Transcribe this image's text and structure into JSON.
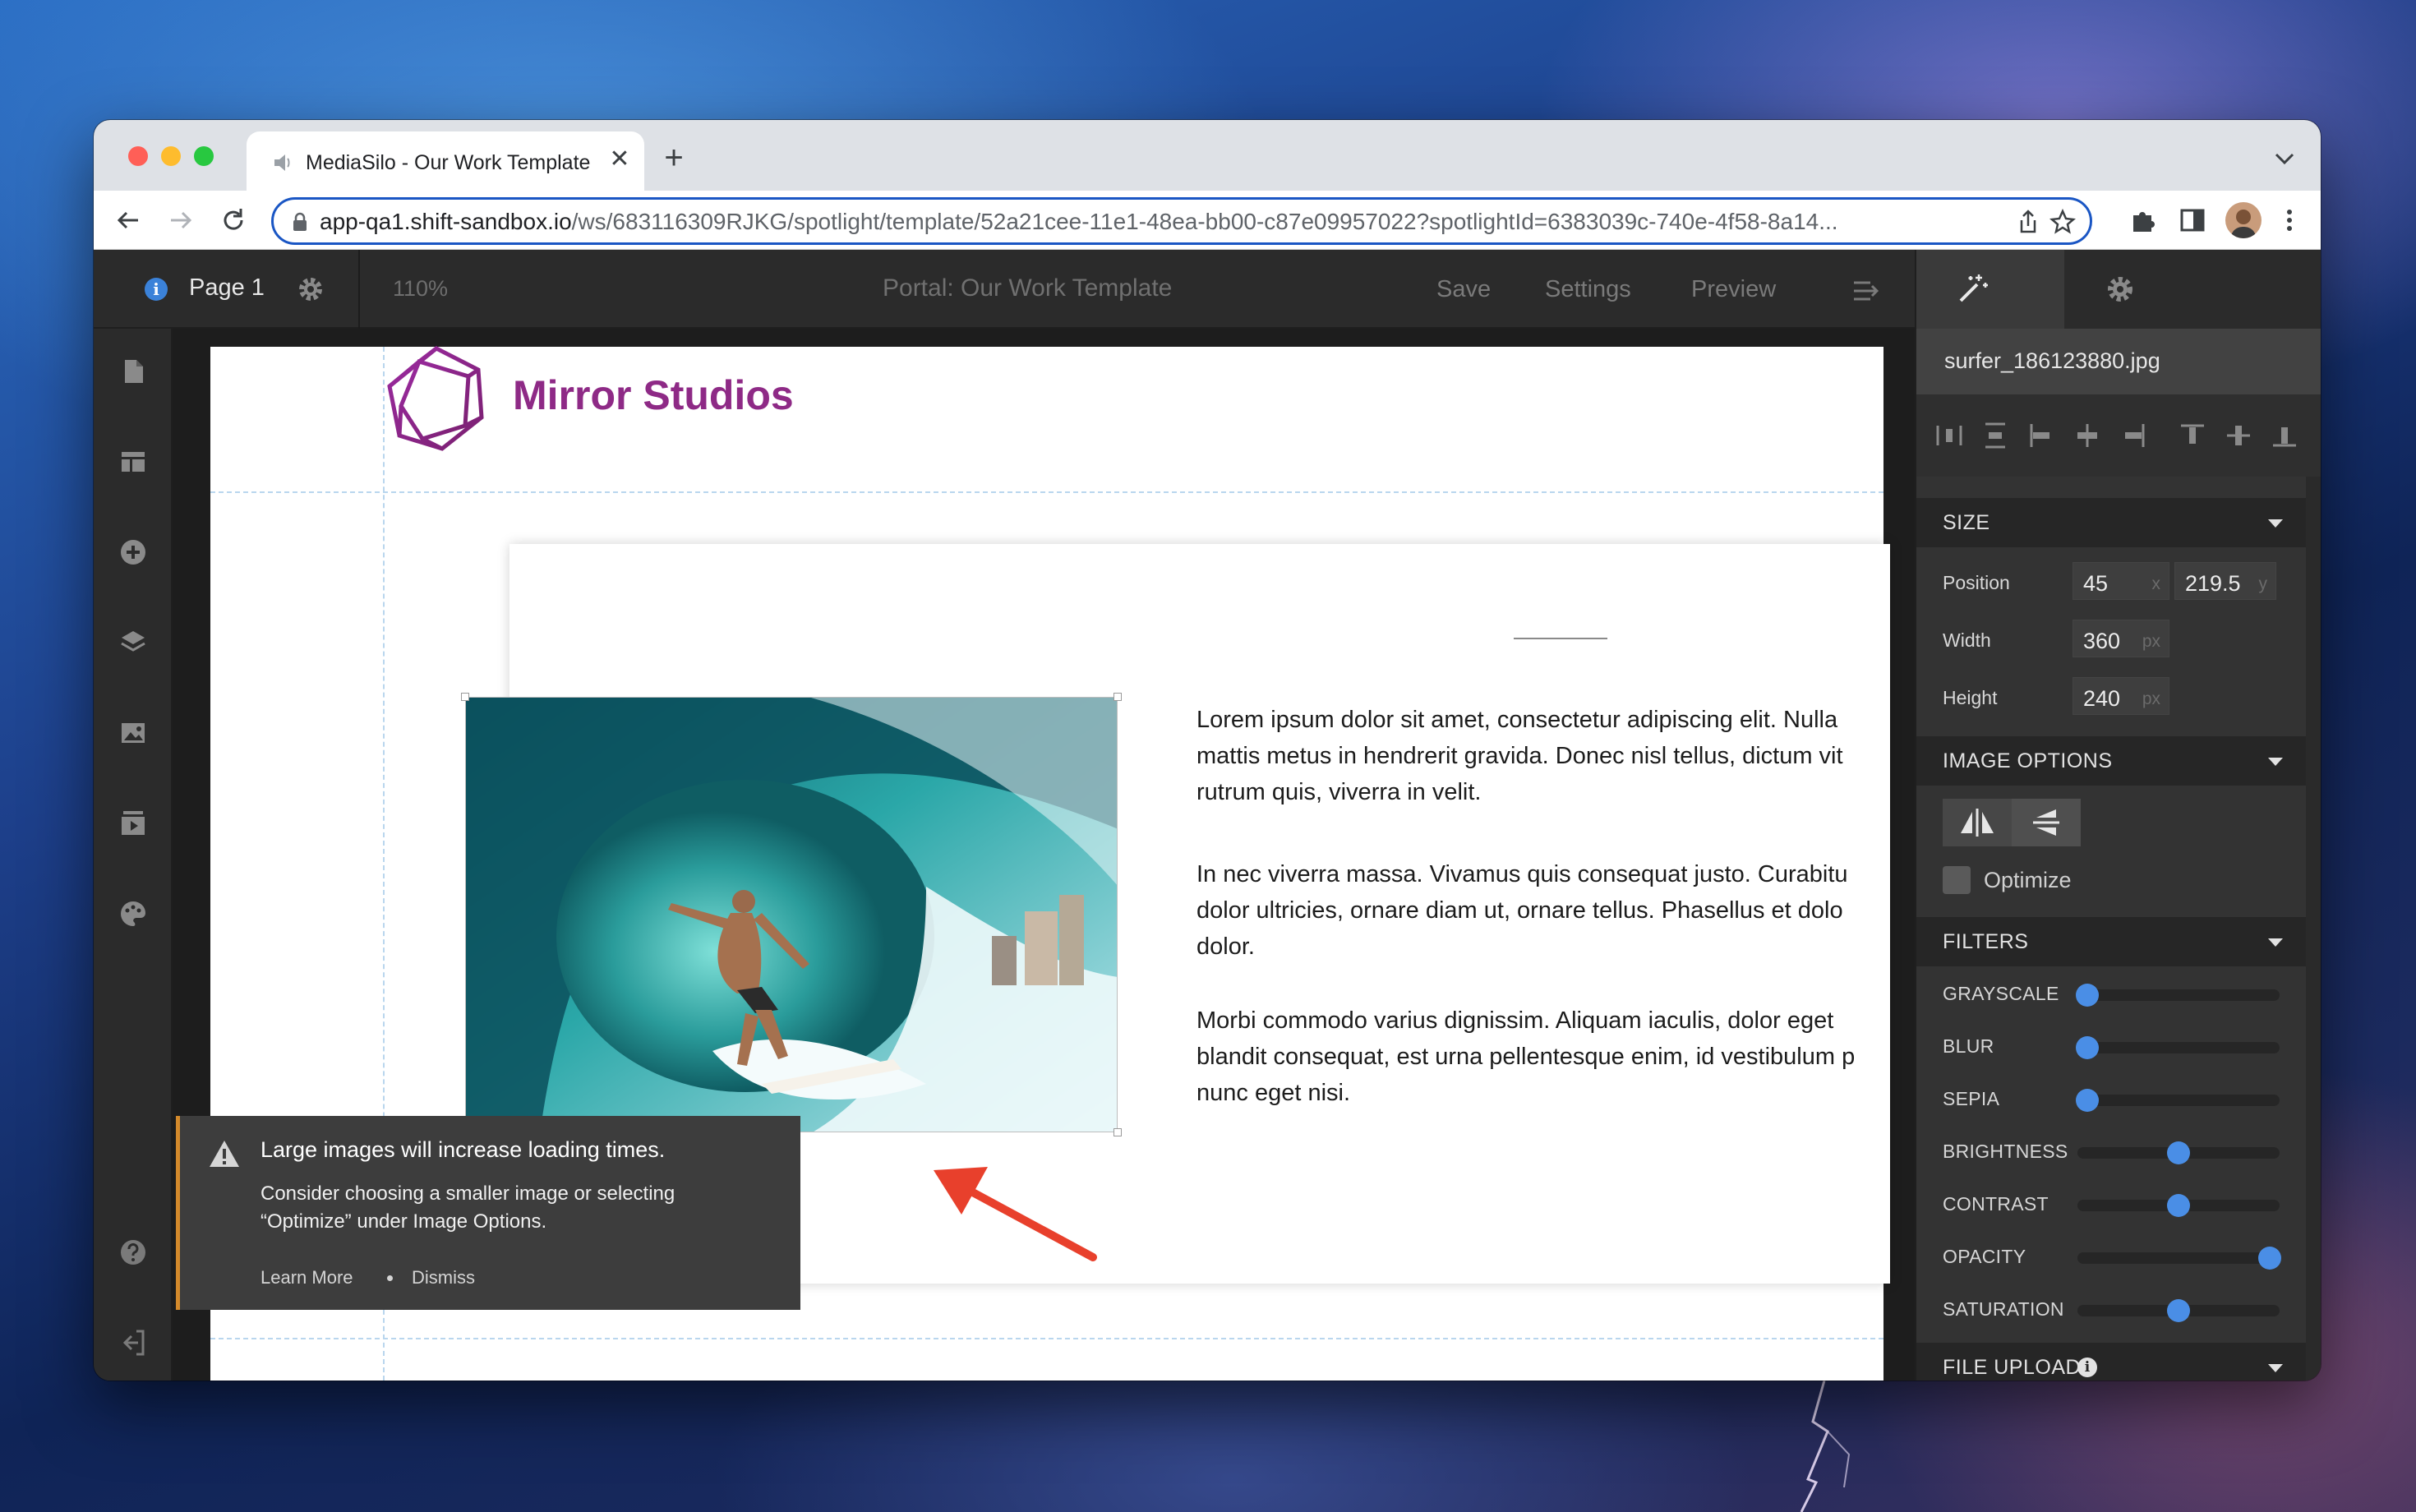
{
  "browser": {
    "tab_title": "MediaSilo - Our Work Template",
    "tab_close": "✕",
    "new_tab": "+",
    "url_host": "app-qa1.shift-sandbox.io",
    "url_path": "/ws/683116309RJKG/spotlight/template/52a21cee-11e1-48ea-bb00-c87e09957022?spotlightId=6383039c-740e-4f58-8a14..."
  },
  "header": {
    "page_name": "Page 1",
    "info_glyph": "i",
    "zoom": "110%",
    "portal_title": "Portal: Our Work Template",
    "save": "Save",
    "settings": "Settings",
    "preview": "Preview"
  },
  "canvas": {
    "brand": "Mirror Studios",
    "paragraphs": [
      [
        "Lorem ipsum dolor sit amet, consectetur adipiscing elit. Nulla",
        "mattis metus in hendrerit gravida. Donec nisl tellus, dictum vit",
        "rutrum quis, viverra in velit."
      ],
      [
        "In nec viverra massa. Vivamus quis consequat justo. Curabitu",
        "dolor ultricies, ornare diam ut, ornare tellus. Phasellus et dolo",
        "dolor."
      ],
      [
        "Morbi commodo varius dignissim. Aliquam iaculis, dolor eget",
        "blandit consequat, est urna pellentesque enim, id vestibulum p",
        "nunc eget nisi."
      ]
    ]
  },
  "toast": {
    "title": "Large images will increase loading times.",
    "body": "Consider choosing a smaller image or selecting “Optimize” under Image Options.",
    "learn_more": "Learn More",
    "dismiss": "Dismiss",
    "accent": "#d48a2b"
  },
  "panel": {
    "filename": "surfer_186123880.jpg",
    "size": {
      "section": "SIZE",
      "position_label": "Position",
      "x": "45",
      "x_unit": "x",
      "y": "219.5",
      "y_unit": "y",
      "width_label": "Width",
      "width": "360",
      "height_label": "Height",
      "height": "240",
      "unit": "px"
    },
    "image_options": {
      "section": "IMAGE OPTIONS",
      "optimize": "Optimize"
    },
    "filters": {
      "section": "FILTERS",
      "items": [
        {
          "label": "GRAYSCALE",
          "level": 0.05
        },
        {
          "label": "BLUR",
          "level": 0.05
        },
        {
          "label": "SEPIA",
          "level": 0.05
        },
        {
          "label": "BRIGHTNESS",
          "level": 0.5
        },
        {
          "label": "CONTRAST",
          "level": 0.5
        },
        {
          "label": "OPACITY",
          "level": 0.95
        },
        {
          "label": "SATURATION",
          "level": 0.5
        }
      ]
    },
    "file_upload": {
      "section": "FILE UPLOAD",
      "info_glyph": "i"
    },
    "accent": "#4a8ee6"
  },
  "colors": {
    "brand": "#8e2a86",
    "omnibox_focus": "#1a56c4"
  }
}
